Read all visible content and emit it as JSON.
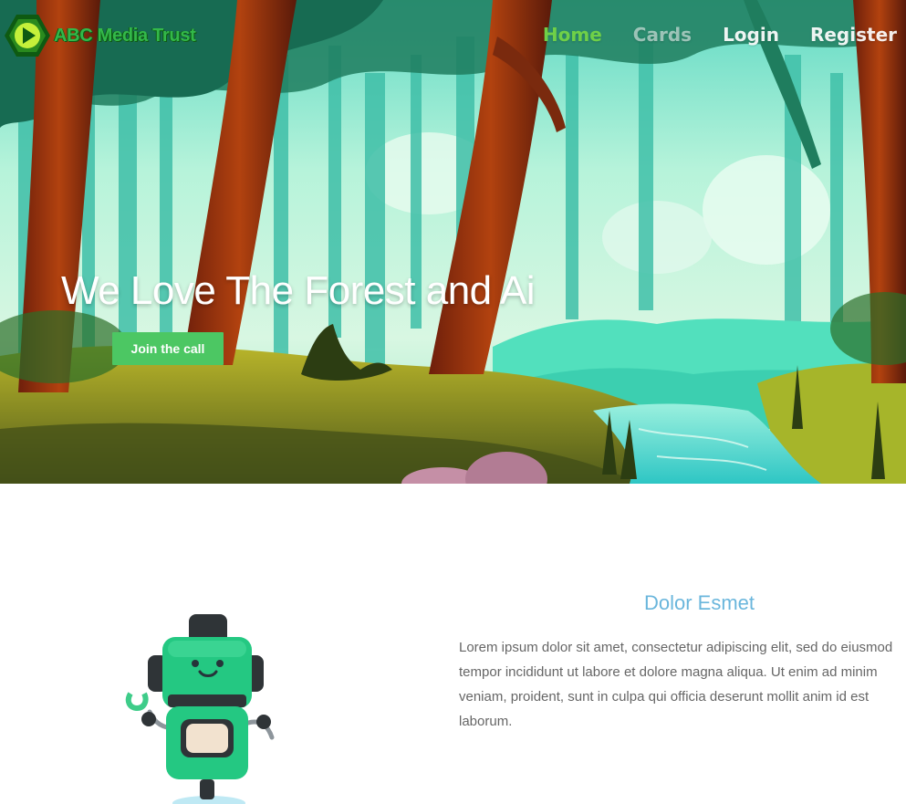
{
  "brand": {
    "name": "ABC Media Trust",
    "logo_icon": "play-hexagon-icon"
  },
  "nav": {
    "items": [
      {
        "label": "Home",
        "state": "active"
      },
      {
        "label": "Cards",
        "state": "faint"
      },
      {
        "label": "Login",
        "state": "normal"
      },
      {
        "label": "Register",
        "state": "normal"
      }
    ]
  },
  "hero": {
    "title": "We Love The Forest and Ai",
    "cta_label": "Join the call"
  },
  "feature": {
    "title": "Dolor Esmet",
    "lines": [
      "Lorem ipsum dolor sit amet, consectetur adipiscing elit, sed do eiusmod",
      "tempor incididunt ut labore et dolore magna aliqua. Ut enim ad minim",
      "veniam, proident, sunt in culpa qui officia deserunt mollit anim id est",
      "laborum."
    ],
    "illustration": "robot-illustration"
  },
  "colors": {
    "accent": "#4cc763",
    "nav_active": "#6fd048",
    "feature_title": "#6ab6dc",
    "brand": "#33b84a"
  }
}
